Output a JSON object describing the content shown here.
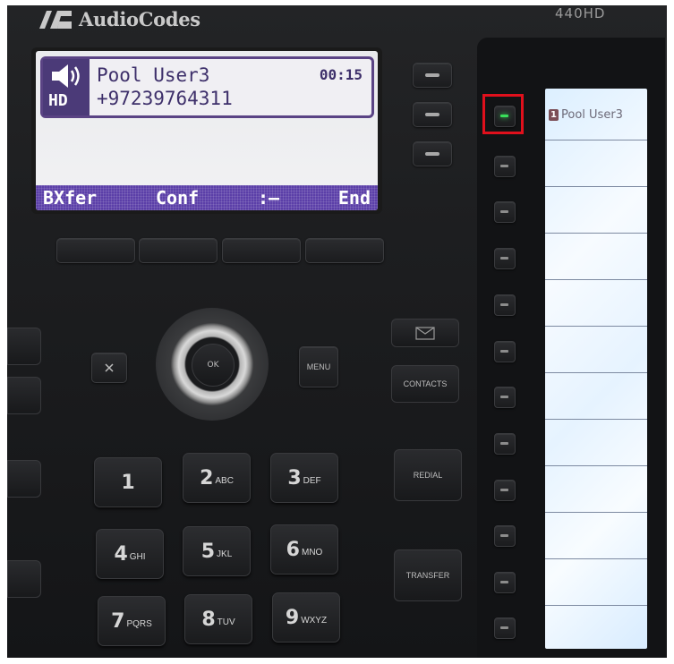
{
  "brand": {
    "name": "AudioCodes",
    "model": "440HD"
  },
  "lcd": {
    "caller_name": "Pool User3",
    "caller_number": "+97239764311",
    "timer": "00:15",
    "hd_badge": "HD",
    "softkeys": [
      "BXfer",
      "Conf",
      ":—",
      "End"
    ]
  },
  "blf": {
    "entries": [
      {
        "index": "1",
        "label": "Pool User3",
        "status": "active"
      }
    ],
    "active_indicator_color": "#39e05a",
    "highlight_color": "#e0101c"
  },
  "nav": {
    "ok_label": "OK",
    "cancel_icon": "close-icon",
    "menu_label": "MENU"
  },
  "function_keys": {
    "messages_icon": "envelope-icon",
    "contacts_label": "CONTACTS",
    "redial_label": "REDIAL",
    "transfer_label": "TRANSFER"
  },
  "keypad": [
    {
      "digit": "1",
      "letters": ""
    },
    {
      "digit": "2",
      "letters": "ABC"
    },
    {
      "digit": "3",
      "letters": "DEF"
    },
    {
      "digit": "4",
      "letters": "GHI"
    },
    {
      "digit": "5",
      "letters": "JKL"
    },
    {
      "digit": "6",
      "letters": "MNO"
    },
    {
      "digit": "7",
      "letters": "PQRS"
    },
    {
      "digit": "8",
      "letters": "TUV"
    },
    {
      "digit": "9",
      "letters": "WXYZ"
    }
  ]
}
